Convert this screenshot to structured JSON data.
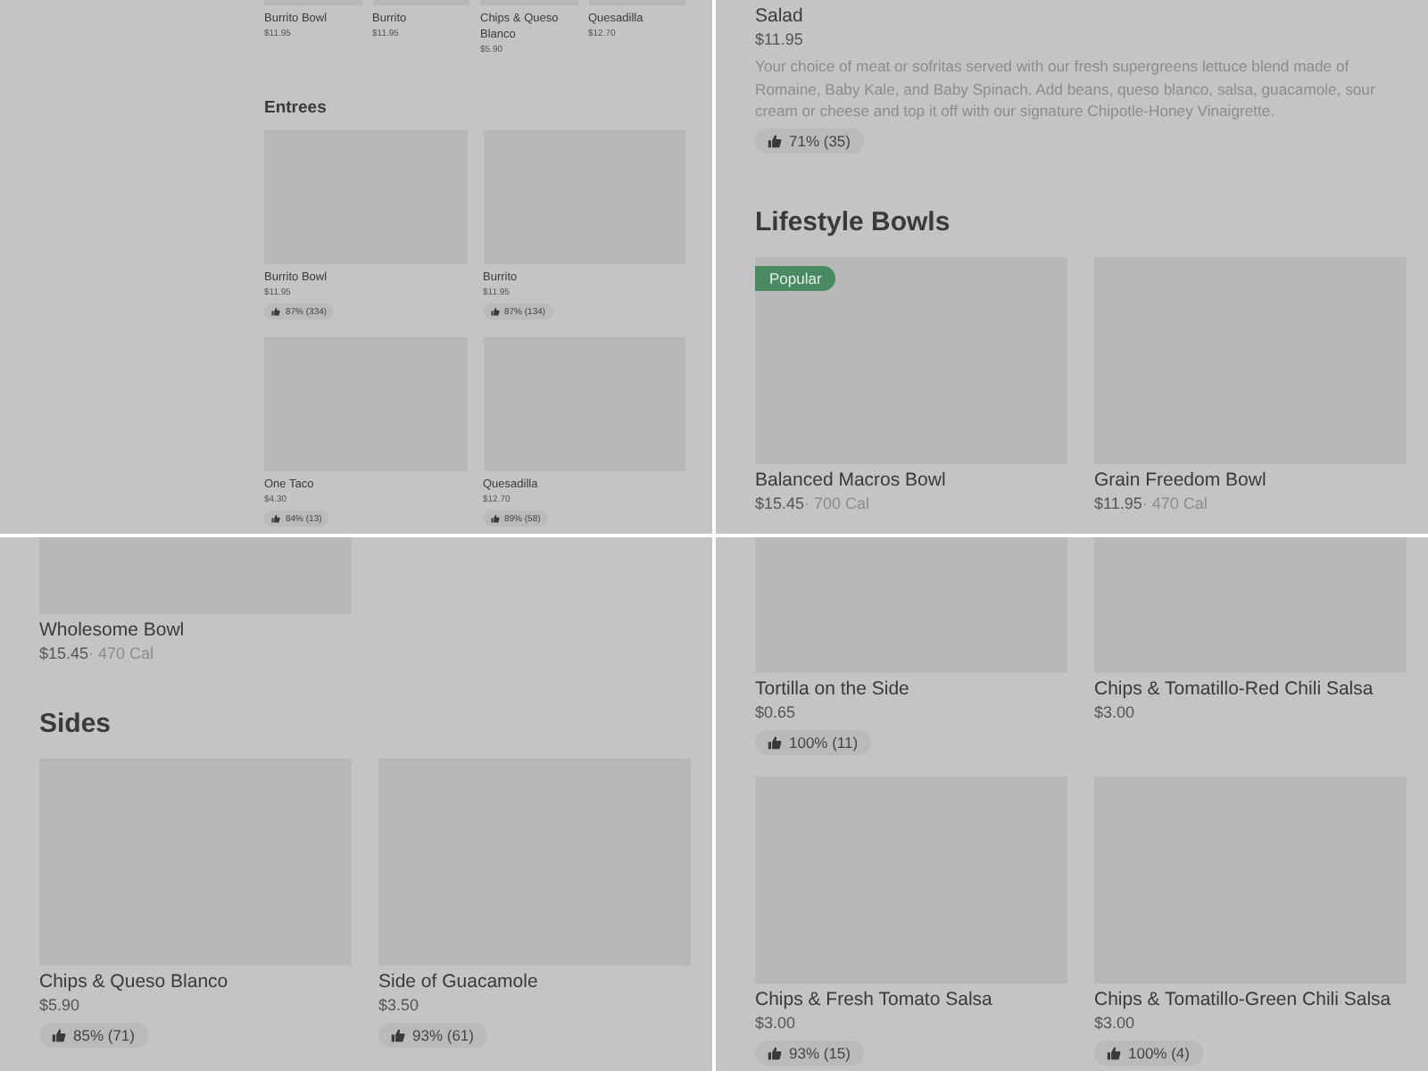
{
  "panels": [
    {
      "blocks": [
        {
          "kind": "strip",
          "items": [
            {
              "name": "Burrito Bowl",
              "price": "$11.95"
            },
            {
              "name": "Burrito",
              "price": "$11.95"
            },
            {
              "name": "Chips & Queso Blanco",
              "price": "$5.90"
            },
            {
              "name": "Quesadilla",
              "price": "$12.70"
            }
          ]
        },
        {
          "kind": "heading",
          "text": "Entrees"
        },
        {
          "kind": "grid",
          "items": [
            {
              "name": "Burrito Bowl",
              "price": "$11.95",
              "rating": "87% (334)"
            },
            {
              "name": "Burrito",
              "price": "$11.95",
              "rating": "87% (134)"
            },
            {
              "name": "One Taco",
              "price": "$4.30",
              "rating": "84% (13)"
            },
            {
              "name": "Quesadilla",
              "price": "$12.70",
              "rating": "89% (58)"
            }
          ]
        }
      ]
    },
    {
      "blocks": [
        {
          "kind": "detail",
          "name": "Salad",
          "price": "$11.95",
          "description": "Your choice of meat or sofritas served with our fresh supergreens lettuce blend made of Romaine, Baby Kale, and Baby Spinach. Add beans, queso blanco, salsa, guacamole, sour cream or cheese and top it off with our signature Chipotle-Honey Vinaigrette.",
          "rating": "71% (35)"
        },
        {
          "kind": "heading",
          "text": "Lifestyle Bowls"
        },
        {
          "kind": "grid",
          "items": [
            {
              "name": "Balanced Macros Bowl",
              "price": "$15.45",
              "calories": "· 700 Cal",
              "badge": "Popular"
            },
            {
              "name": "Grain Freedom Bowl",
              "price": "$11.95",
              "calories": "· 470 Cal"
            }
          ]
        }
      ]
    },
    {
      "blocks": [
        {
          "kind": "cut_grid",
          "items": [
            {
              "name": "Wholesome Bowl",
              "price": "$15.45",
              "calories": "· 470 Cal"
            }
          ]
        },
        {
          "kind": "heading",
          "text": "Sides"
        },
        {
          "kind": "grid",
          "items": [
            {
              "name": "Chips & Queso Blanco",
              "price": "$5.90",
              "rating": "85% (71)"
            },
            {
              "name": "Side of Guacamole",
              "price": "$3.50",
              "rating": "93% (61)"
            }
          ]
        }
      ]
    },
    {
      "blocks": [
        {
          "kind": "cut_grid",
          "items": [
            {
              "name": "Tortilla on the Side",
              "price": "$0.65",
              "rating": "100% (11)"
            },
            {
              "name": "Chips & Tomatillo-Red Chili Salsa",
              "price": "$3.00"
            }
          ]
        },
        {
          "kind": "grid",
          "items": [
            {
              "name": "Chips & Fresh Tomato Salsa",
              "price": "$3.00",
              "rating": "93% (15)"
            },
            {
              "name": "Chips & Tomatillo-Green Chili Salsa",
              "price": "$3.00",
              "rating": "100% (4)"
            }
          ]
        }
      ]
    }
  ]
}
